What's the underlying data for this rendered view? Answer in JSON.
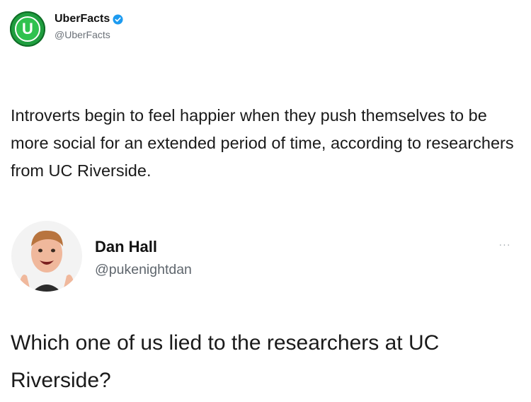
{
  "quoted_tweet": {
    "name": "UberFacts",
    "handle": "@UberFacts",
    "avatar_letter": "U",
    "verified_icon": "verified-badge-icon",
    "text": "Introverts begin to feel happier when they push themselves to be more social for an extended period of time, according to researchers from UC Riverside."
  },
  "reply_tweet": {
    "name": "Dan Hall",
    "handle": "@pukenightdan",
    "more_label": "···",
    "text": "Which one of us lied to the researchers at UC Riverside?"
  },
  "colors": {
    "brand_green": "#2fc24f",
    "verified_blue": "#1d9bf0",
    "handle_gray": "#6b7178"
  }
}
